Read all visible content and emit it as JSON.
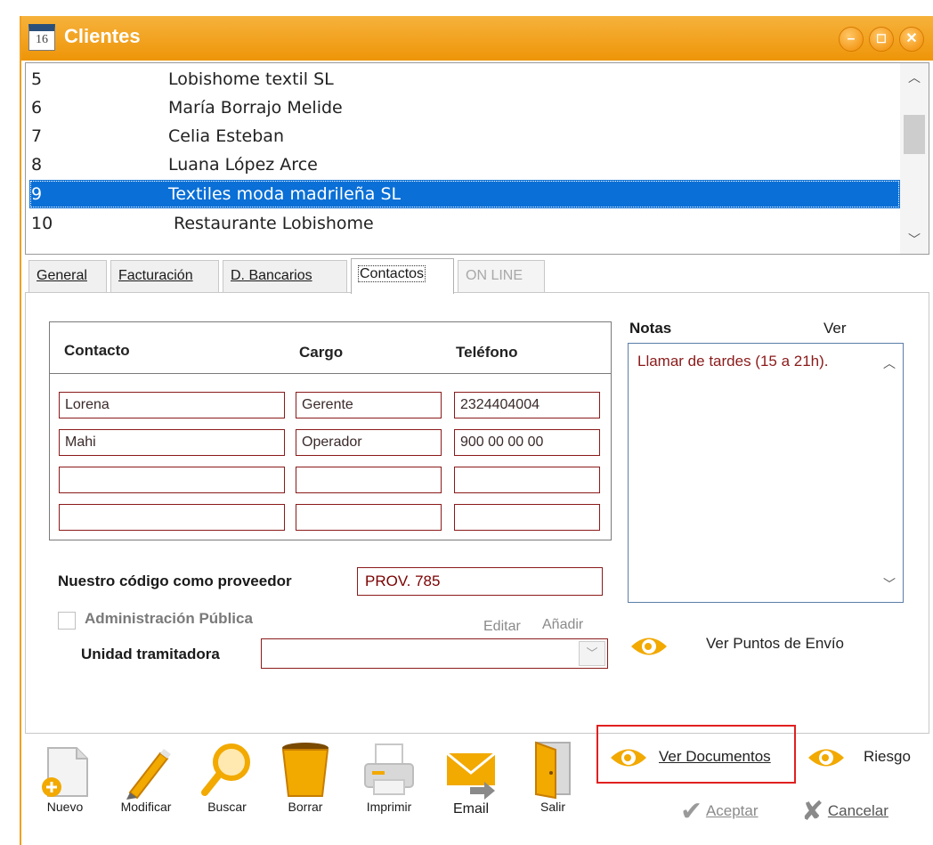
{
  "window": {
    "title": "Clientes",
    "app_icon_text": "16"
  },
  "clients": [
    {
      "code": "5",
      "name": "Lobishome textil SL",
      "selected": false
    },
    {
      "code": "6",
      "name": "María Borrajo Melide",
      "selected": false
    },
    {
      "code": "7",
      "name": "Celia Esteban",
      "selected": false
    },
    {
      "code": "8",
      "name": "Luana López Arce",
      "selected": false
    },
    {
      "code": "9",
      "name": "Textiles moda madrileña SL",
      "selected": true
    },
    {
      "code": "10",
      "name": "Restaurante Lobishome",
      "selected": false
    }
  ],
  "tabs": [
    {
      "label": "General"
    },
    {
      "label": "Facturación"
    },
    {
      "label": "D. Bancarios"
    },
    {
      "label": "Contactos",
      "active": true
    },
    {
      "label": "ON LINE",
      "disabled": true
    }
  ],
  "contacts": {
    "headers": {
      "contacto": "Contacto",
      "cargo": "Cargo",
      "telefono": "Teléfono"
    },
    "rows": [
      {
        "contacto": "Lorena",
        "cargo": "Gerente",
        "telefono": "2324404004"
      },
      {
        "contacto": "Mahi",
        "cargo": "Operador",
        "telefono": "900 00 00 00"
      },
      {
        "contacto": "",
        "cargo": "",
        "telefono": ""
      },
      {
        "contacto": "",
        "cargo": "",
        "telefono": ""
      }
    ]
  },
  "notes": {
    "label": "Notas",
    "ver_label": "Ver",
    "text": "Llamar de tardes (15 a 21h)."
  },
  "provider": {
    "label": "Nuestro código como proveedor",
    "value": "PROV. 785"
  },
  "admin": {
    "label": "Administración Pública",
    "checked": false,
    "editar": "Editar",
    "anadir": "Añadir"
  },
  "unidad": {
    "label": "Unidad tramitadora",
    "value": ""
  },
  "links": {
    "ver_puntos": "Ver Puntos de Envío",
    "ver_documentos": "Ver Documentos",
    "riesgo": "Riesgo"
  },
  "toolbar": {
    "nuevo": "Nuevo",
    "modificar": "Modificar",
    "buscar": "Buscar",
    "borrar": "Borrar",
    "imprimir": "Imprimir",
    "email": "Email",
    "salir": "Salir",
    "aceptar": "Aceptar",
    "cancelar": "Cancelar"
  },
  "colors": {
    "title_bar": "#ee9508",
    "selection": "#0a6fd6",
    "field_border": "#8b1a1a",
    "highlight": "#e02020"
  }
}
